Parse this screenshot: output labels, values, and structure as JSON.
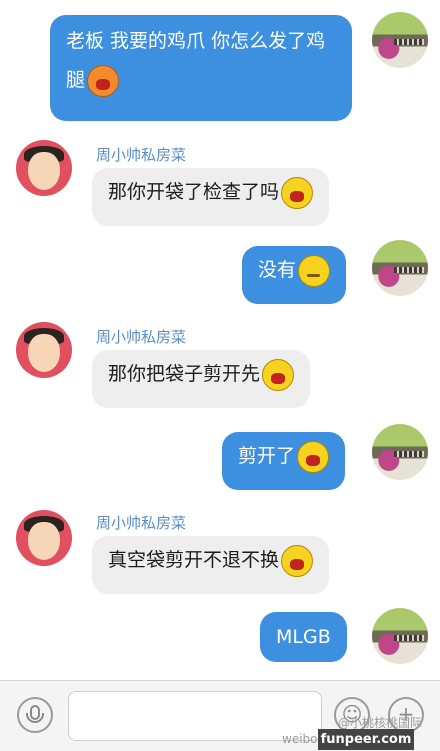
{
  "contact": {
    "name": "周小帅私房菜"
  },
  "messages": [
    {
      "from": "me",
      "text": "老板 我要的鸡爪 你怎么发了鸡腿",
      "emoji": "angry-orange-emoji"
    },
    {
      "from": "them",
      "name": "周小帅私房菜",
      "text": "那你开袋了检查了吗",
      "emoji": "shouting-emoji"
    },
    {
      "from": "me",
      "text": "没有",
      "emoji": "calm-emoji"
    },
    {
      "from": "them",
      "name": "周小帅私房菜",
      "text": "那你把袋子剪开先",
      "emoji": "shouting-emoji"
    },
    {
      "from": "me",
      "text": "剪开了",
      "emoji": "shouting-emoji"
    },
    {
      "from": "them",
      "name": "周小帅私房菜",
      "text": "真空袋剪开不退不换",
      "emoji": "shouting-emoji"
    },
    {
      "from": "me",
      "text": "MLGB"
    }
  ],
  "input_bar": {
    "voice_icon": "microphone-icon",
    "emoji_icon": "emoji-icon",
    "add_icon": "plus-icon",
    "placeholder": ""
  },
  "watermark": {
    "weibo_text": "@小桃核桃国际",
    "site_text": "weibo.com/...mily",
    "badge_text": "funpeer.com"
  },
  "colors": {
    "outgoing": "#3d8fe0",
    "incoming": "#eeeeee",
    "name": "#5a8dc6"
  }
}
